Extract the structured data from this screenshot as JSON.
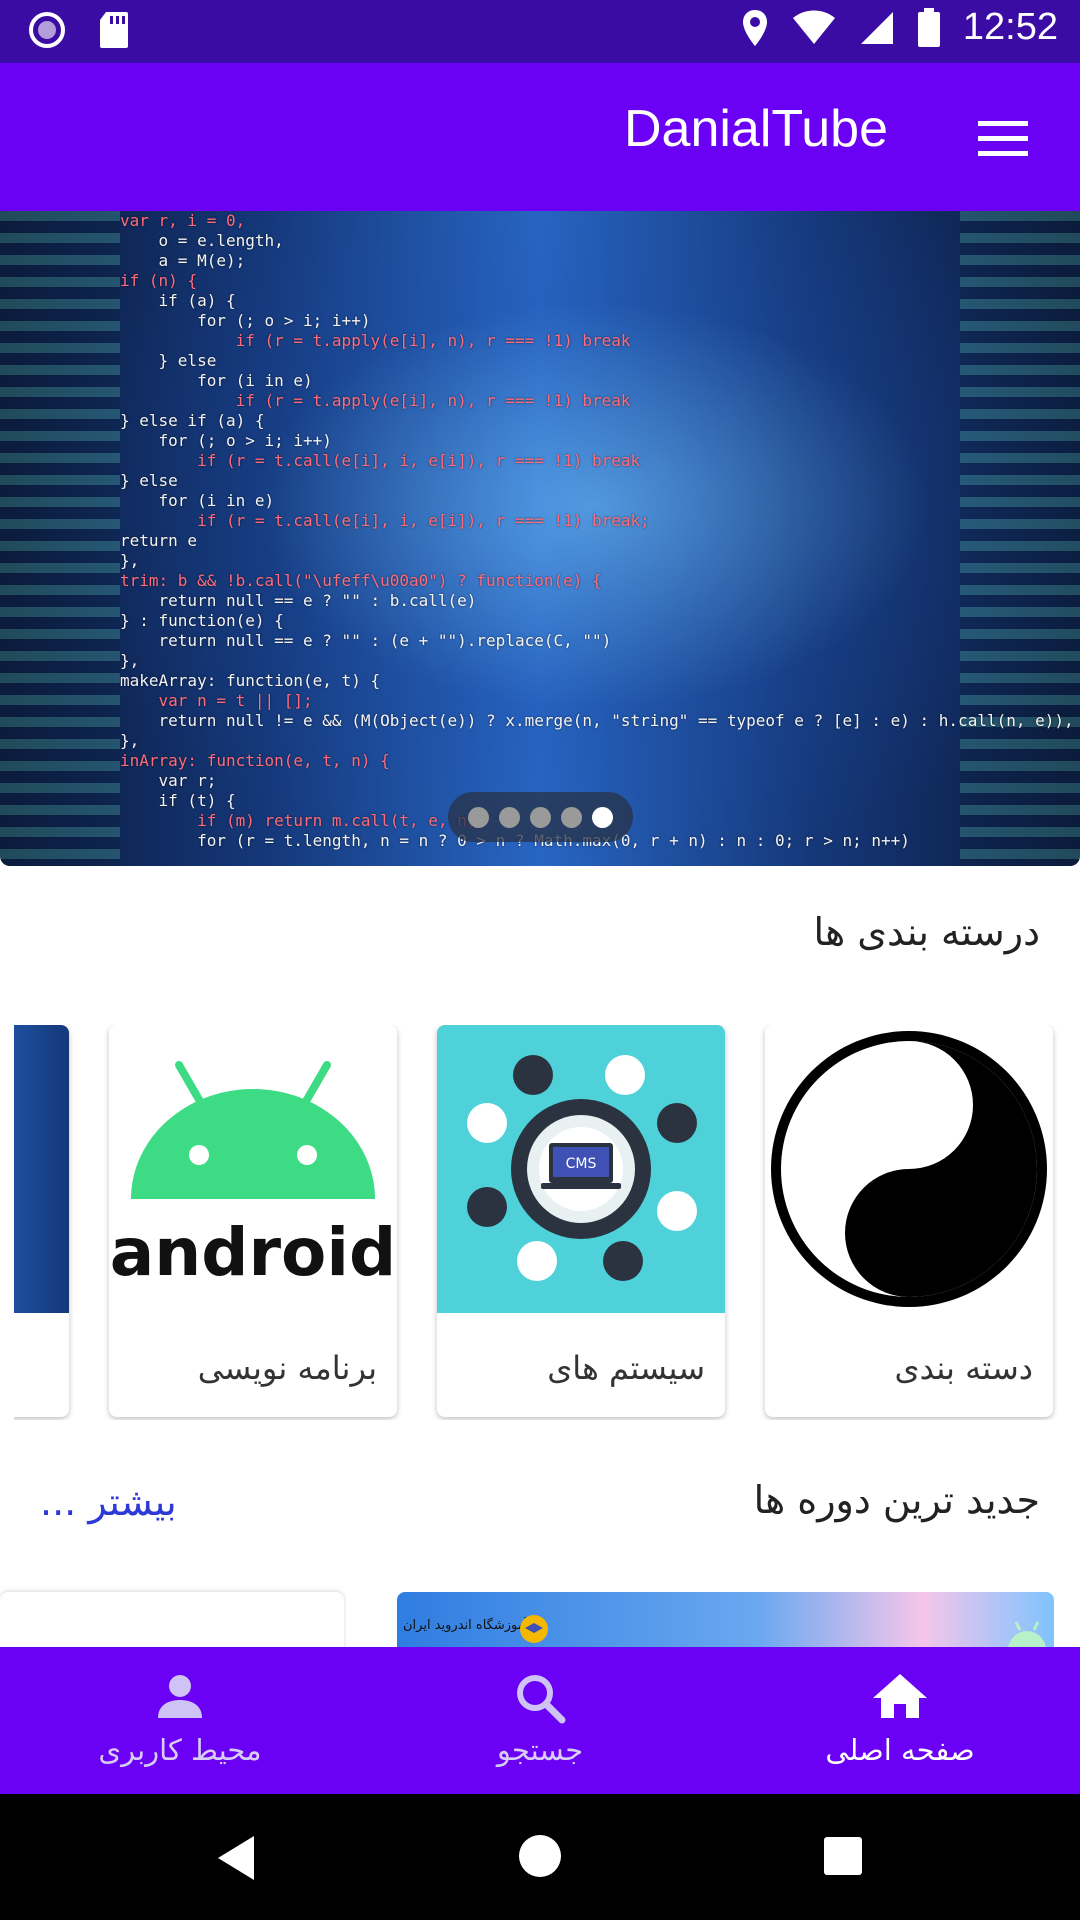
{
  "status_bar": {
    "time": "12:52",
    "left_icons": [
      "record-icon",
      "sd-card-icon"
    ],
    "right_icons": [
      "location-icon",
      "wifi-icon",
      "signal-icon",
      "battery-icon"
    ]
  },
  "app_bar": {
    "title": "DanialTube",
    "menu_icon": "hamburger-menu-icon"
  },
  "banner": {
    "code_lines": [
      "var r, i = 0,",
      "    o = e.length,",
      "    a = M(e);",
      "if (n) {",
      "    if (a) {",
      "        for (; o > i; i++)",
      "            if (r = t.apply(e[i], n), r === !1) break",
      "    } else",
      "        for (i in e)",
      "            if (r = t.apply(e[i], n), r === !1) break",
      "} else if (a) {",
      "    for (; o > i; i++)",
      "        if (r = t.call(e[i], i, e[i]), r === !1) break",
      "} else",
      "    for (i in e)",
      "        if (r = t.call(e[i], i, e[i]), r === !1) break;",
      "return e",
      "},",
      "trim: b && !b.call(\"\\ufeff\\u00a0\") ? function(e) {",
      "    return null == e ? \"\" : b.call(e)",
      "} : function(e) {",
      "    return null == e ? \"\" : (e + \"\").replace(C, \"\")",
      "},",
      "makeArray: function(e, t) {",
      "    var n = t || [];",
      "    return null != e && (M(Object(e)) ? x.merge(n, \"string\" == typeof e ? [e] : e) : h.call(n, e)), n",
      "},",
      "inArray: function(e, t, n) {",
      "    var r;",
      "    if (t) {",
      "        if (m) return m.call(t, e, n);",
      "        for (r = t.length, n = n ? 0 > n ? Math.max(0, r + n) : n : 0; r > n; n++)"
    ],
    "slide_count": 5,
    "active_slide": 5
  },
  "categories_section": {
    "title": "درسته بندی ها",
    "cards": [
      {
        "label": "دسته بندی",
        "image": "yin-yang-icon"
      },
      {
        "label": "سیستم های",
        "image": "cms-illustration"
      },
      {
        "label": "برنامه نویسی",
        "image": "android-logo",
        "logo_text": "android"
      },
      {
        "label": "",
        "image": "server-room-thumbnail"
      }
    ]
  },
  "courses_section": {
    "title": "جدید ترین دوره ها",
    "more_link": "بیشتر ...",
    "first_card_caption": "آموزشگاه اندروید ایران"
  },
  "bottom_nav": {
    "items": [
      {
        "label": "صفحه اصلی",
        "icon": "home-icon",
        "active": true
      },
      {
        "label": "جستجو",
        "icon": "search-icon",
        "active": false
      },
      {
        "label": "محیط کاربری",
        "icon": "user-icon",
        "active": false
      }
    ]
  },
  "system_nav": {
    "buttons": [
      "back-triangle-icon",
      "home-circle-icon",
      "recents-square-icon"
    ]
  },
  "colors": {
    "primary": "#6a00f4",
    "status_bar": "#3a0ca3",
    "link": "#2d39d6",
    "android_green": "#3ddc84"
  }
}
